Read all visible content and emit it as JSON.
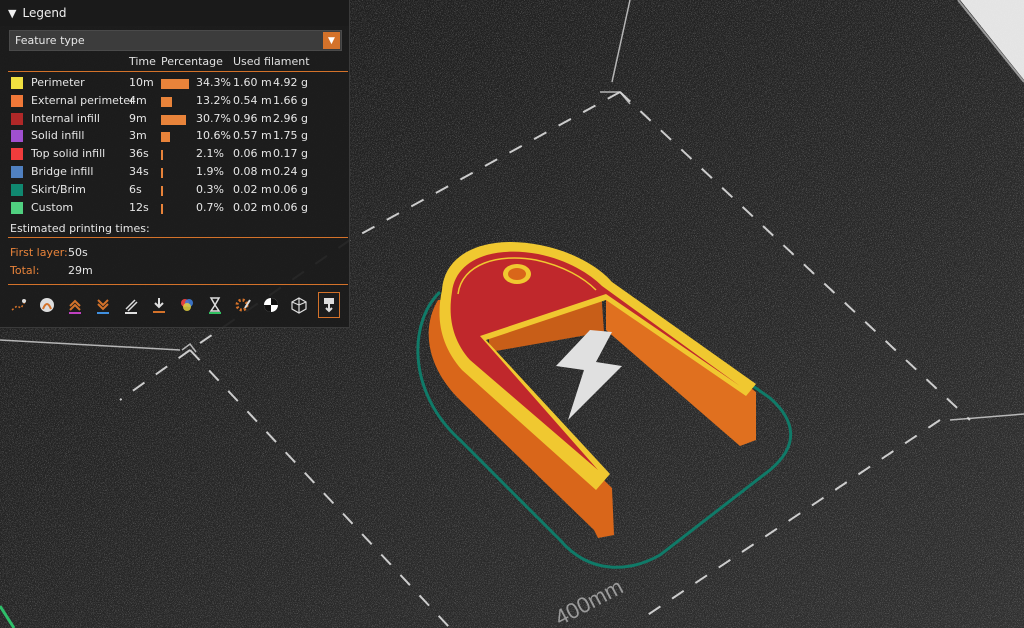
{
  "legend": {
    "title": "Legend",
    "combo_value": "Feature type",
    "columns": {
      "time": "Time",
      "percentage": "Percentage",
      "filament": "Used filament"
    },
    "rows": [
      {
        "name": "Perimeter",
        "color": "#f0e040",
        "time": "10m",
        "pct": "34.3%",
        "pct_value": 34.3,
        "len": "1.60 m",
        "weight": "4.92 g"
      },
      {
        "name": "External perimeter",
        "color": "#f07838",
        "time": "4m",
        "pct": "13.2%",
        "pct_value": 13.2,
        "len": "0.54 m",
        "weight": "1.66 g"
      },
      {
        "name": "Internal infill",
        "color": "#b02828",
        "time": "9m",
        "pct": "30.7%",
        "pct_value": 30.7,
        "len": "0.96 m",
        "weight": "2.96 g"
      },
      {
        "name": "Solid infill",
        "color": "#a050d0",
        "time": "3m",
        "pct": "10.6%",
        "pct_value": 10.6,
        "len": "0.57 m",
        "weight": "1.75 g"
      },
      {
        "name": "Top solid infill",
        "color": "#f03c3c",
        "time": "36s",
        "pct": "2.1%",
        "pct_value": 2.1,
        "len": "0.06 m",
        "weight": "0.17 g"
      },
      {
        "name": "Bridge infill",
        "color": "#5080c0",
        "time": "34s",
        "pct": "1.9%",
        "pct_value": 1.9,
        "len": "0.08 m",
        "weight": "0.24 g"
      },
      {
        "name": "Skirt/Brim",
        "color": "#108870",
        "time": "6s",
        "pct": "0.3%",
        "pct_value": 0.3,
        "len": "0.02 m",
        "weight": "0.06 g"
      },
      {
        "name": "Custom",
        "color": "#50d080",
        "time": "12s",
        "pct": "0.7%",
        "pct_value": 0.7,
        "len": "0.02 m",
        "weight": "0.06 g"
      }
    ],
    "estimated_title": "Estimated printing times:",
    "first_layer_label": "First layer:",
    "first_layer_value": "50s",
    "total_label": "Total:",
    "total_value": "29m"
  },
  "toolbar_icons": [
    "travel-icon",
    "wipe-icon",
    "retractions-icon",
    "deretractions-icon",
    "seams-icon",
    "tool-changes-icon",
    "color-changes-icon",
    "pause-prints-icon",
    "custom-gcodes-icon",
    "center-of-gravity-icon",
    "shells-icon",
    "tool-marker-icon"
  ],
  "viewport": {
    "bed_label": "400mm"
  },
  "colors": {
    "accent": "#d4722a",
    "model_orange": "#e8741f",
    "model_red": "#c0282c",
    "perimeter_yellow": "#f0c830",
    "skirt": "#107a68"
  }
}
